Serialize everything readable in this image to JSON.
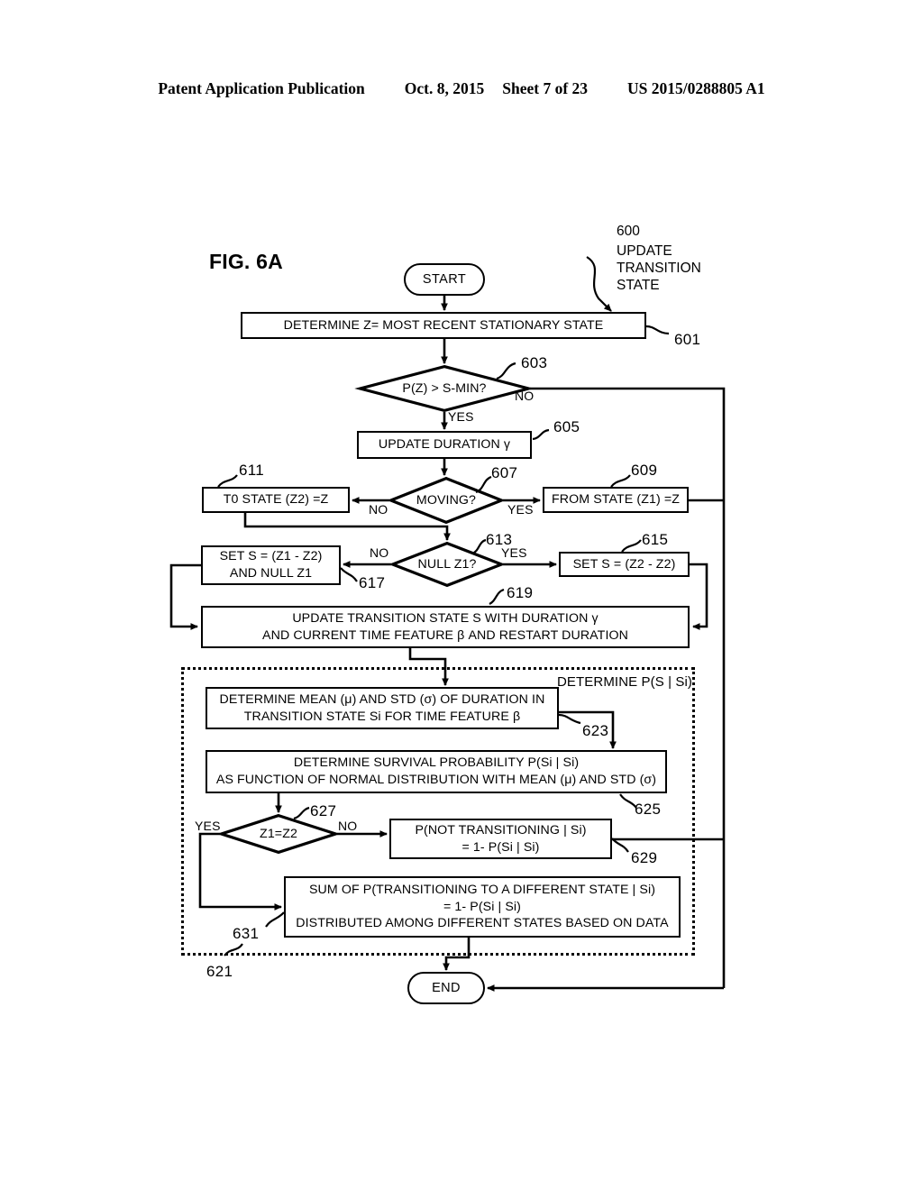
{
  "header": {
    "publication": "Patent Application Publication",
    "date": "Oct. 8, 2015",
    "sheet": "Sheet 7 of 23",
    "docnum": "US 2015/0288805 A1"
  },
  "figure": {
    "label": "FIG. 6A",
    "callout_number": "600",
    "callout_line1": "UPDATE",
    "callout_line2": "TRANSITION",
    "callout_line3": "STATE"
  },
  "nodes": {
    "start": {
      "text": "START"
    },
    "end": {
      "text": "END"
    },
    "n601": {
      "ref": "601",
      "text": "DETERMINE  Z= MOST RECENT STATIONARY STATE"
    },
    "n603": {
      "ref": "603",
      "text": "P(Z) > S-MIN?",
      "yes": "YES",
      "no": "NO"
    },
    "n605": {
      "ref": "605",
      "text": "UPDATE DURATION γ"
    },
    "n607": {
      "ref": "607",
      "text": "MOVING?",
      "yes": "YES",
      "no": "NO"
    },
    "n609": {
      "ref": "609",
      "text": "FROM STATE (Z1) =Z"
    },
    "n611": {
      "ref": "611",
      "text": "T0 STATE (Z2) =Z"
    },
    "n613": {
      "ref": "613",
      "text": "NULL Z1?",
      "yes": "YES",
      "no": "NO"
    },
    "n615": {
      "ref": "615",
      "text": "SET S = (Z2 - Z2)"
    },
    "n617": {
      "ref": "617",
      "line1": "SET S = (Z1 - Z2)",
      "line2": "AND NULL Z1"
    },
    "n619": {
      "ref": "619",
      "line1": "UPDATE TRANSITION STATE S WITH DURATION γ",
      "line2": "AND CURRENT TIME FEATURE β AND RESTART DURATION"
    },
    "n621": {
      "ref": "621",
      "region_label": "DETERMINE P(S | Si)"
    },
    "n623": {
      "ref": "623",
      "line1": "DETERMINE MEAN (μ) AND STD (σ) OF DURATION IN",
      "line2": "TRANSITION STATE Si FOR TIME FEATURE β"
    },
    "n625": {
      "ref": "625",
      "line1": "DETERMINE SURVIVAL PROBABILITY P(Si | Si)",
      "line2": "AS FUNCTION OF NORMAL DISTRIBUTION WITH MEAN (μ) AND STD (σ)"
    },
    "n627": {
      "ref": "627",
      "text": "Z1=Z2",
      "yes": "YES",
      "no": "NO"
    },
    "n629": {
      "ref": "629",
      "line1": "P(NOT TRANSITIONING | Si)",
      "line2": "= 1- P(Si | Si)"
    },
    "n631": {
      "ref": "631",
      "line1": "SUM OF P(TRANSITIONING TO A DIFFERENT STATE |  Si)",
      "line2": "= 1- P(Si | Si)",
      "line3": "DISTRIBUTED AMONG DIFFERENT STATES BASED ON DATA"
    }
  }
}
